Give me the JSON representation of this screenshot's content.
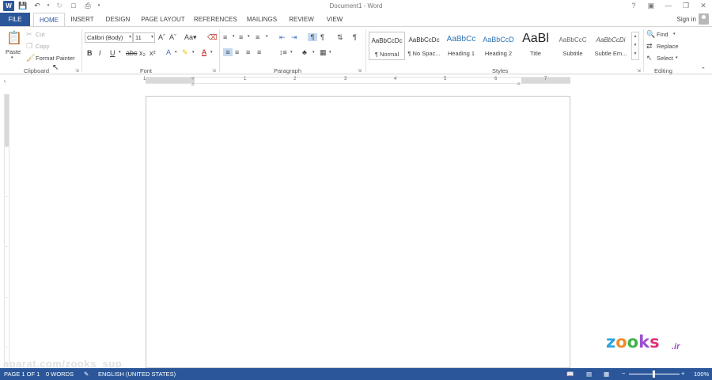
{
  "app": {
    "title": "Document1 - Word",
    "sign_in": "Sign in"
  },
  "tabs": [
    "FILE",
    "HOME",
    "INSERT",
    "DESIGN",
    "PAGE LAYOUT",
    "REFERENCES",
    "MAILINGS",
    "REVIEW",
    "VIEW"
  ],
  "ribbon": {
    "clipboard": {
      "label": "Clipboard",
      "paste": "Paste",
      "cut": "Cut",
      "copy": "Copy",
      "format_painter": "Format Painter"
    },
    "font": {
      "label": "Font",
      "font_name": "Calibri (Body)",
      "font_size": "11"
    },
    "paragraph": {
      "label": "Paragraph"
    },
    "styles": {
      "label": "Styles",
      "items": [
        {
          "sample": "AaBbCcDc",
          "name": "¶ Normal"
        },
        {
          "sample": "AaBbCcDc",
          "name": "¶ No Spac..."
        },
        {
          "sample": "AaBbCc",
          "name": "Heading 1"
        },
        {
          "sample": "AaBbCcD",
          "name": "Heading 2"
        },
        {
          "sample": "AaBl",
          "name": "Title"
        },
        {
          "sample": "AaBbCcC",
          "name": "Subtitle"
        },
        {
          "sample": "AaBbCcDi",
          "name": "Subtle Em..."
        }
      ]
    },
    "editing": {
      "label": "Editing",
      "find": "Find",
      "replace": "Replace",
      "select": "Select"
    }
  },
  "ruler": {
    "numbers": [
      "1",
      "1",
      "2",
      "3",
      "4",
      "5",
      "6",
      "7"
    ]
  },
  "status": {
    "page": "PAGE 1 OF 1",
    "words": "0 WORDS",
    "language": "ENGLISH (UNITED STATES)",
    "zoom": "100%"
  },
  "watermark": {
    "logo": "zooks",
    "suffix": ".ir",
    "text": "aparat.com/zooks_sup"
  },
  "colors": {
    "accent": "#2b579a"
  }
}
